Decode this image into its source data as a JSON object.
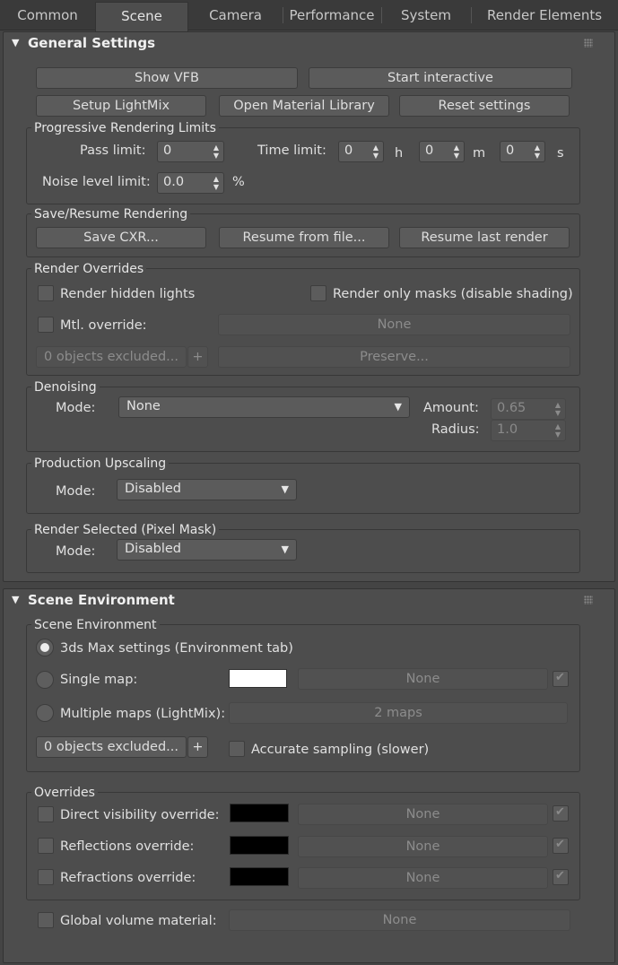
{
  "tabs": [
    "Common",
    "Scene",
    "Camera",
    "Performance",
    "System",
    "Render Elements"
  ],
  "active_tab": "Scene",
  "general": {
    "title": "General Settings",
    "show_vfb": "Show VFB",
    "start_interactive": "Start interactive",
    "setup_lightmix": "Setup LightMix",
    "open_material_library": "Open Material Library",
    "reset_settings": "Reset settings",
    "progressive": {
      "label": "Progressive Rendering Limits",
      "pass_limit_label": "Pass limit:",
      "pass_limit": "0",
      "time_limit_label": "Time limit:",
      "hours": "0",
      "h": "h",
      "minutes": "0",
      "m": "m",
      "seconds": "0",
      "s": "s",
      "noise_label": "Noise level limit:",
      "noise": "0.0",
      "percent": "%"
    },
    "save_resume": {
      "label": "Save/Resume Rendering",
      "save_cxr": "Save CXR...",
      "resume_file": "Resume from file...",
      "resume_last": "Resume last render"
    },
    "overrides": {
      "label": "Render Overrides",
      "hidden_lights": "Render hidden lights",
      "only_masks": "Render only masks (disable shading)",
      "mtl_override": "Mtl. override:",
      "mtl_value": "None",
      "excluded": "0 objects excluded...",
      "plus": "+",
      "preserve": "Preserve..."
    },
    "denoising": {
      "label": "Denoising",
      "mode_label": "Mode:",
      "mode": "None",
      "amount_label": "Amount:",
      "amount": "0.65",
      "radius_label": "Radius:",
      "radius": "1.0"
    },
    "upscaling": {
      "label": "Production Upscaling",
      "mode_label": "Mode:",
      "mode": "Disabled"
    },
    "render_selected": {
      "label": "Render Selected (Pixel Mask)",
      "mode_label": "Mode:",
      "mode": "Disabled"
    }
  },
  "scene_env": {
    "title": "Scene Environment",
    "group_label": "Scene Environment",
    "max_settings": "3ds Max settings (Environment tab)",
    "single_map": "Single map:",
    "single_map_value": "None",
    "multiple_maps": "Multiple maps (LightMix):",
    "multiple_maps_value": "2 maps",
    "excluded": "0 objects excluded...",
    "plus": "+",
    "accurate": "Accurate sampling (slower)",
    "overrides": {
      "label": "Overrides",
      "direct": "Direct visibility override:",
      "direct_value": "None",
      "reflections": "Reflections override:",
      "reflections_value": "None",
      "refractions": "Refractions override:",
      "refractions_value": "None"
    },
    "global_volume": "Global volume material:",
    "global_volume_value": "None"
  },
  "colors": {
    "swatch_white": "#ffffff",
    "swatch_black": "#000000"
  }
}
